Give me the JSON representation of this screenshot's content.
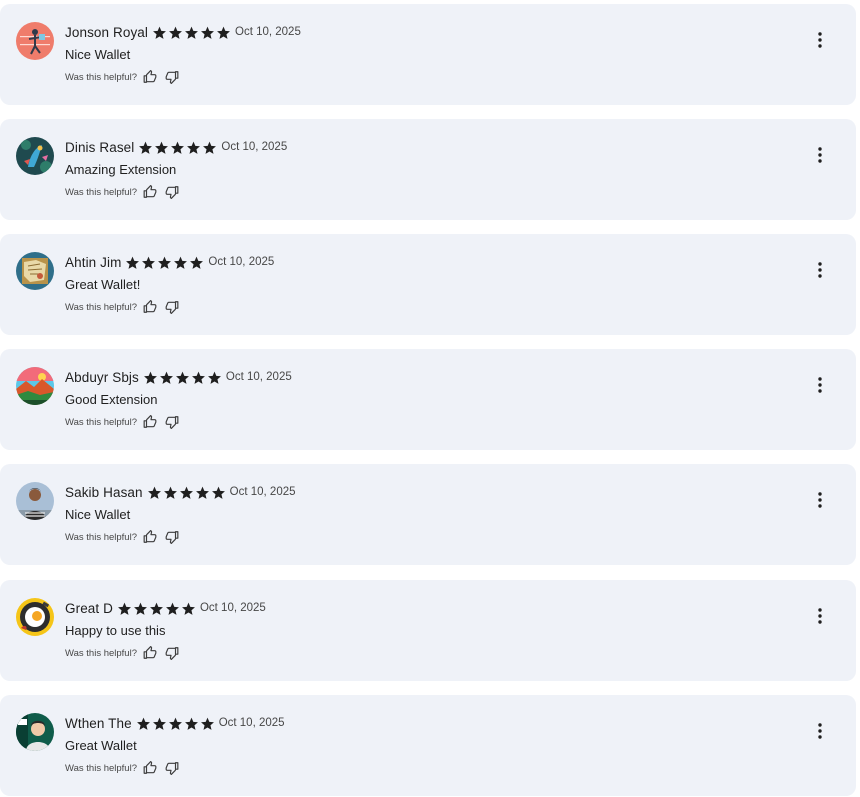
{
  "helpful_label": "Was this helpful?",
  "star_color": "#1f1f1f",
  "card_background": "#eff2f8",
  "reviews": [
    {
      "name": "Jonson Royal",
      "rating": 5,
      "date": "Oct 10, 2025",
      "text": "Nice Wallet",
      "avatar": "coral-figure-avatar"
    },
    {
      "name": "Dinis Rasel",
      "rating": 5,
      "date": "Oct 10, 2025",
      "text": "Amazing Extension",
      "avatar": "bird-avatar"
    },
    {
      "name": "Ahtin Jim",
      "rating": 5,
      "date": "Oct 10, 2025",
      "text": "Great Wallet!",
      "avatar": "map-avatar"
    },
    {
      "name": "Abduyr Sbjs",
      "rating": 5,
      "date": "Oct 10, 2025",
      "text": "Good Extension",
      "avatar": "landscape-avatar"
    },
    {
      "name": "Sakib Hasan",
      "rating": 5,
      "date": "Oct 10, 2025",
      "text": "Nice Wallet",
      "avatar": "person-photo-avatar"
    },
    {
      "name": "Great D",
      "rating": 5,
      "date": "Oct 10, 2025",
      "text": "Happy to use this",
      "avatar": "fried-egg-avatar"
    },
    {
      "name": "Wthen The",
      "rating": 5,
      "date": "Oct 10, 2025",
      "text": "Great Wallet",
      "avatar": "api-person-avatar"
    }
  ]
}
